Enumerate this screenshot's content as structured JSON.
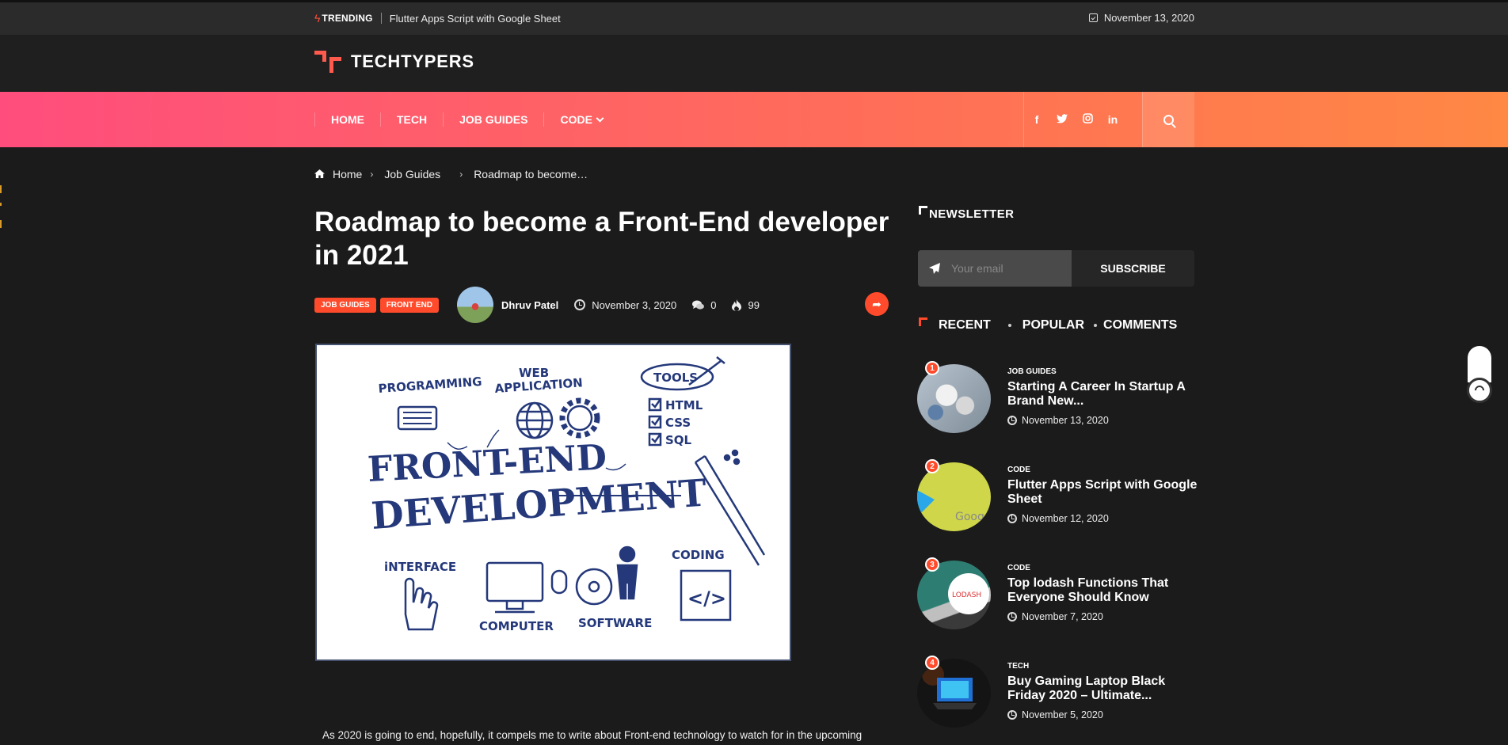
{
  "topbar": {
    "trending_label": "TRENDING",
    "trending_link": "Flutter Apps Script with Google Sheet",
    "date": "November 13, 2020"
  },
  "brand": {
    "name": "TECHTYPERS",
    "accent": "#ff5a4e"
  },
  "nav": {
    "items": [
      {
        "label": "HOME"
      },
      {
        "label": "TECH"
      },
      {
        "label": "JOB GUIDES"
      },
      {
        "label": "CODE"
      }
    ],
    "socials": [
      "f",
      "twitter-icon",
      "instagram-icon",
      "in"
    ],
    "gradient": [
      "#ff4d7d",
      "#ff8844"
    ]
  },
  "breadcrumb": [
    "Home",
    "Job Guides",
    "Roadmap to become…"
  ],
  "article": {
    "title": "Roadmap to become a Front-End developer in 2021",
    "tags": [
      "JOB GUIDES",
      "FRONT END"
    ],
    "author": "Dhruv Patel",
    "date": "November 3, 2020",
    "comments": "0",
    "views": "99",
    "image_text": {
      "headline1": "FRONT-END",
      "headline2": "DEVELOPMENT",
      "programming": "PROGRAMMING",
      "web": "WEB",
      "application": "APPLICATION",
      "tools": "TOOLS",
      "html": "HTML",
      "css": "CSS",
      "sql": "SQL",
      "interface": "iNTERFACE",
      "computer": "COMPUTER",
      "software": "SOFTWARE",
      "coding": "CODING",
      "code_tag": "</>"
    },
    "intro": "As 2020 is going to end, hopefully, it compels me to write about Front-end technology to watch for in the upcoming"
  },
  "sidebar": {
    "newsletter_title": "NEWSLETTER",
    "email_placeholder": "Your email",
    "subscribe_label": "SUBSCRIBE",
    "tabs": [
      "RECENT",
      "POPULAR",
      "COMMENTS"
    ],
    "posts": [
      {
        "num": "1",
        "category": "JOB GUIDES",
        "title": "Starting A Career In Startup A Brand New...",
        "date": "November 13, 2020"
      },
      {
        "num": "2",
        "category": "CODE",
        "title": "Flutter Apps Script with Google Sheet",
        "date": "November 12, 2020",
        "thumb_text": "Goog"
      },
      {
        "num": "3",
        "category": "CODE",
        "title": "Top lodash Functions That Everyone Should Know",
        "date": "November 7, 2020",
        "thumb_text": "LODASH"
      },
      {
        "num": "4",
        "category": "TECH",
        "title": "Buy Gaming Laptop Black Friday 2020 – Ultimate...",
        "date": "November 5, 2020"
      }
    ]
  }
}
